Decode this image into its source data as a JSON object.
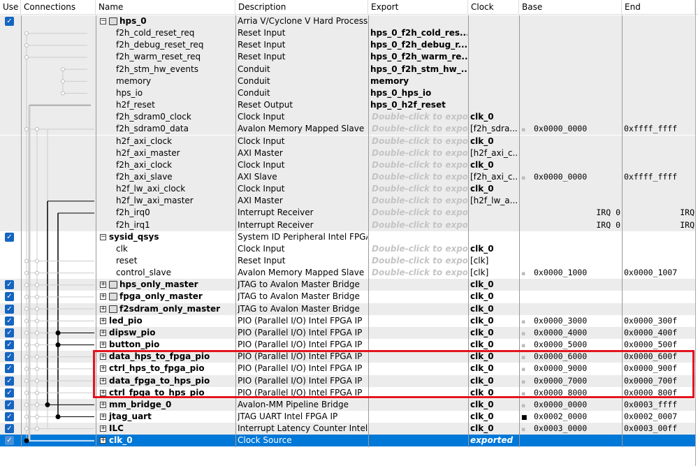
{
  "columns": [
    "Use",
    "Connections",
    "Name",
    "Description",
    "Export",
    "Clock",
    "Base",
    "End"
  ],
  "export_hint": "Double-click to export",
  "rows": [
    {
      "use": true,
      "name": "hps_0",
      "level": 0,
      "expander": "-",
      "comp_icon": true,
      "desc": "Arria V/Cyclone V Hard Process...",
      "export": "",
      "clock": "",
      "base": "",
      "end": ""
    },
    {
      "name": "f2h_cold_reset_req",
      "level": 1,
      "desc": "Reset Input",
      "export": "hps_0_f2h_cold_res...",
      "export_bold": true
    },
    {
      "name": "f2h_debug_reset_req",
      "level": 1,
      "desc": "Reset Input",
      "export": "hps_0_f2h_debug_r...",
      "export_bold": true
    },
    {
      "name": "f2h_warm_reset_req",
      "level": 1,
      "desc": "Reset Input",
      "export": "hps_0_f2h_warm_re...",
      "export_bold": true
    },
    {
      "name": "f2h_stm_hw_events",
      "level": 1,
      "desc": "Conduit",
      "export": "hps_0_f2h_stm_hw_...",
      "export_bold": true
    },
    {
      "name": "memory",
      "level": 1,
      "desc": "Conduit",
      "export": "memory",
      "export_bold": true
    },
    {
      "name": "hps_io",
      "level": 1,
      "desc": "Conduit",
      "export": "hps_0_hps_io",
      "export_bold": true
    },
    {
      "name": "h2f_reset",
      "level": 1,
      "desc": "Reset Output",
      "export": "hps_0_h2f_reset",
      "export_bold": true
    },
    {
      "name": "f2h_sdram0_clock",
      "level": 1,
      "desc": "Clock Input",
      "hint": true,
      "clock": "clk_0",
      "clock_bold": true
    },
    {
      "name": "f2h_sdram0_data",
      "level": 1,
      "desc": "Avalon Memory Mapped Slave",
      "hint": true,
      "clock": "[f2h_sdra...",
      "lock": "open",
      "base": "0x0000_0000",
      "end": "0xffff_ffff"
    },
    {
      "name": "h2f_axi_clock",
      "level": 1,
      "desc": "Clock Input",
      "hint": true,
      "clock": "clk_0",
      "clock_bold": true
    },
    {
      "name": "h2f_axi_master",
      "level": 1,
      "desc": "AXI Master",
      "hint": true,
      "clock": "[h2f_axi_c..."
    },
    {
      "name": "f2h_axi_clock",
      "level": 1,
      "desc": "Clock Input",
      "hint": true,
      "clock": "clk_0",
      "clock_bold": true
    },
    {
      "name": "f2h_axi_slave",
      "level": 1,
      "desc": "AXI Slave",
      "hint": true,
      "clock": "[f2h_axi_c...",
      "lock": "open",
      "base": "0x0000_0000",
      "end": "0xffff_ffff"
    },
    {
      "name": "h2f_lw_axi_clock",
      "level": 1,
      "desc": "Clock Input",
      "hint": true,
      "clock": "clk_0",
      "clock_bold": true
    },
    {
      "name": "h2f_lw_axi_master",
      "level": 1,
      "desc": "AXI Master",
      "hint": true,
      "clock": "[h2f_lw_a..."
    },
    {
      "name": "f2h_irq0",
      "level": 1,
      "desc": "Interrupt Receiver",
      "hint": true,
      "irq_base": "IRQ 0",
      "irq_end": "IRQ"
    },
    {
      "name": "f2h_irq1",
      "level": 1,
      "desc": "Interrupt Receiver",
      "hint": true,
      "irq_base": "IRQ 0",
      "irq_end": "IRQ"
    },
    {
      "use": true,
      "name": "sysid_qsys",
      "level": 0,
      "expander": "-",
      "desc": "System ID Peripheral Intel FPGA..."
    },
    {
      "name": "clk",
      "level": 1,
      "desc": "Clock Input",
      "hint": true,
      "clock": "clk_0",
      "clock_bold": true
    },
    {
      "name": "reset",
      "level": 1,
      "desc": "Reset Input",
      "hint": true,
      "clock": "[clk]"
    },
    {
      "name": "control_slave",
      "level": 1,
      "desc": "Avalon Memory Mapped Slave",
      "hint": true,
      "clock": "[clk]",
      "lock": "open",
      "base": "0x0000_1000",
      "end": "0x0000_1007"
    },
    {
      "use": true,
      "name": "hps_only_master",
      "level": 0,
      "expander": "+",
      "comp_icon": true,
      "desc": "JTAG to Avalon Master Bridge",
      "clock": "clk_0",
      "clock_bold": true
    },
    {
      "use": true,
      "name": "fpga_only_master",
      "level": 0,
      "expander": "+",
      "comp_icon": true,
      "desc": "JTAG to Avalon Master Bridge",
      "clock": "clk_0",
      "clock_bold": true
    },
    {
      "use": true,
      "name": "f2sdram_only_master",
      "level": 0,
      "expander": "+",
      "comp_icon": true,
      "desc": "JTAG to Avalon Master Bridge",
      "clock": "clk_0",
      "clock_bold": true
    },
    {
      "use": true,
      "name": "led_pio",
      "level": 0,
      "expander": "+",
      "desc": "PIO (Parallel I/O) Intel FPGA IP",
      "clock": "clk_0",
      "clock_bold": true,
      "lock": "open",
      "base": "0x0000_3000",
      "end": "0x0000_300f"
    },
    {
      "use": true,
      "name": "dipsw_pio",
      "level": 0,
      "expander": "+",
      "desc": "PIO (Parallel I/O) Intel FPGA IP",
      "clock": "clk_0",
      "clock_bold": true,
      "lock": "open",
      "base": "0x0000_4000",
      "end": "0x0000_400f"
    },
    {
      "use": true,
      "name": "button_pio",
      "level": 0,
      "expander": "+",
      "desc": "PIO (Parallel I/O) Intel FPGA IP",
      "clock": "clk_0",
      "clock_bold": true,
      "lock": "open",
      "base": "0x0000_5000",
      "end": "0x0000_500f"
    },
    {
      "use": true,
      "name": "data_hps_to_fpga_pio",
      "level": 0,
      "expander": "+",
      "desc": "PIO (Parallel I/O) Intel FPGA IP",
      "clock": "clk_0",
      "clock_bold": true,
      "lock": "open",
      "base": "0x0000_6000",
      "end": "0x0000_600f"
    },
    {
      "use": true,
      "name": "ctrl_hps_to_fpga_pio",
      "level": 0,
      "expander": "+",
      "desc": "PIO (Parallel I/O) Intel FPGA IP",
      "clock": "clk_0",
      "clock_bold": true,
      "lock": "open",
      "base": "0x0000_9000",
      "end": "0x0000_900f"
    },
    {
      "use": true,
      "name": "data_fpga_to_hps_pio",
      "level": 0,
      "expander": "+",
      "desc": "PIO (Parallel I/O) Intel FPGA IP",
      "clock": "clk_0",
      "clock_bold": true,
      "lock": "open",
      "base": "0x0000_7000",
      "end": "0x0000_700f"
    },
    {
      "use": true,
      "name": "ctrl_fpga_to_hps_pio",
      "level": 0,
      "expander": "+",
      "desc": "PIO (Parallel I/O) Intel FPGA IP",
      "clock": "clk_0",
      "clock_bold": true,
      "lock": "open",
      "base": "0x0000_8000",
      "end": "0x0000_800f"
    },
    {
      "use": true,
      "name": "mm_bridge_0",
      "level": 0,
      "expander": "+",
      "desc": "Avalon-MM Pipeline Bridge",
      "clock": "clk_0",
      "clock_bold": true,
      "lock": "open",
      "base": "0x0000_0000",
      "end": "0x0003_ffff"
    },
    {
      "use": true,
      "name": "jtag_uart",
      "level": 0,
      "expander": "+",
      "desc": "JTAG UART Intel FPGA IP",
      "clock": "clk_0",
      "clock_bold": true,
      "lock": "locked",
      "base": "0x0002_0000",
      "end": "0x0002_0007"
    },
    {
      "use": true,
      "name": "ILC",
      "level": 0,
      "expander": "+",
      "desc": "Interrupt Latency Counter Intel ...",
      "clock": "clk_0",
      "clock_bold": true,
      "lock": "open",
      "base": "0x0003_0000",
      "end": "0x0003_00ff"
    },
    {
      "use": true,
      "name": "clk_0",
      "level": 0,
      "expander": "+",
      "desc": "Clock Source",
      "clock": "exported",
      "clock_italic": true,
      "selected": true
    }
  ],
  "colors": {
    "selected": "#0078d7",
    "highlight_box": "#e3141e",
    "stripe": "#ececec"
  }
}
